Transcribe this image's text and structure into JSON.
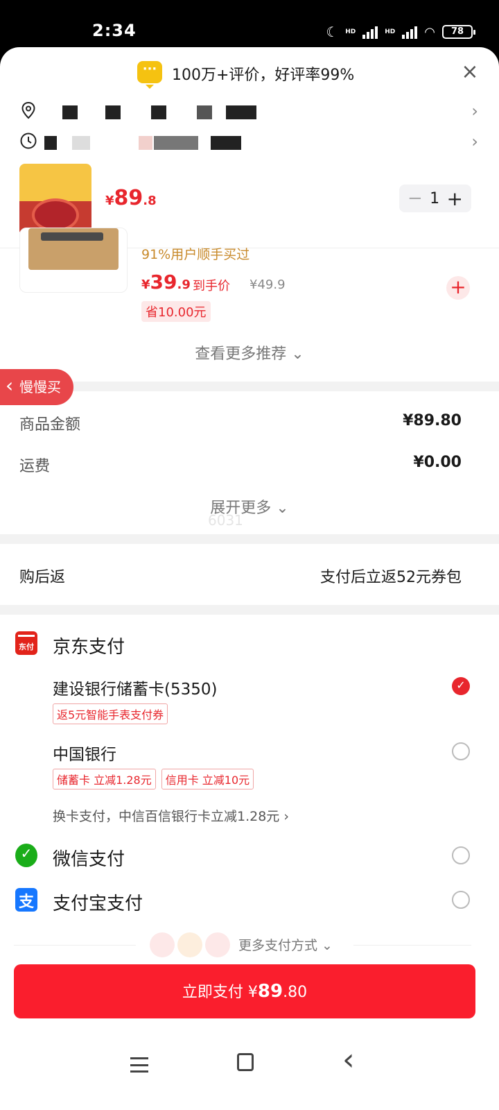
{
  "status": {
    "time": "2:34",
    "hd1": "HD",
    "hd2": "HD",
    "battery": "78"
  },
  "banner": {
    "text": "100万+评价，好评率99%",
    "icon": "message-icon"
  },
  "address": {
    "icon": "location-pin-icon"
  },
  "delivery_time": {
    "icon": "clock-icon"
  },
  "product": {
    "price_yen": "¥",
    "price_int": "89",
    "price_dec": ".8",
    "quantity": "1"
  },
  "recommendation": {
    "tag": "91%用户顺手买过",
    "price_yen": "¥",
    "price_int": "39",
    "price_dec": ".9",
    "price_label": "到手价",
    "original_price": "¥49.9",
    "saving": "省10.00元"
  },
  "see_more": "查看更多推荐 ⌄",
  "slow_buy": "慢慢买",
  "summary": {
    "goods_label": "商品金额",
    "goods_value": "¥89.80",
    "shipping_label": "运费",
    "shipping_value": "¥0.00",
    "expand": "展开更多 ⌄",
    "ghost": "6031"
  },
  "cashback": {
    "label": "购后返",
    "value": "支付后立返52元券包"
  },
  "payment": {
    "jd": {
      "logo_text": "东付",
      "title": "京东支付",
      "cards": [
        {
          "name": "建设银行储蓄卡(5350)",
          "tags": [
            "返5元智能手表支付券"
          ],
          "selected": true
        },
        {
          "name": "中国银行",
          "tags": [
            "储蓄卡 立减1.28元",
            "信用卡 立减10元"
          ],
          "selected": false
        }
      ],
      "switch_card": "换卡支付，中信百信银行卡立减1.28元 ›"
    },
    "wechat": {
      "title": "微信支付",
      "selected": false
    },
    "alipay": {
      "logo_text": "支",
      "title": "支付宝支付",
      "selected": false
    },
    "more": "更多支付方式 ⌄"
  },
  "pay_button": {
    "label": "立即支付",
    "yen": "¥",
    "amount_int": "89",
    "amount_dec": ".80"
  },
  "colors": {
    "accent": "#fa1e2d",
    "price": "#e8262d",
    "tag_gold": "#c88a2b"
  }
}
